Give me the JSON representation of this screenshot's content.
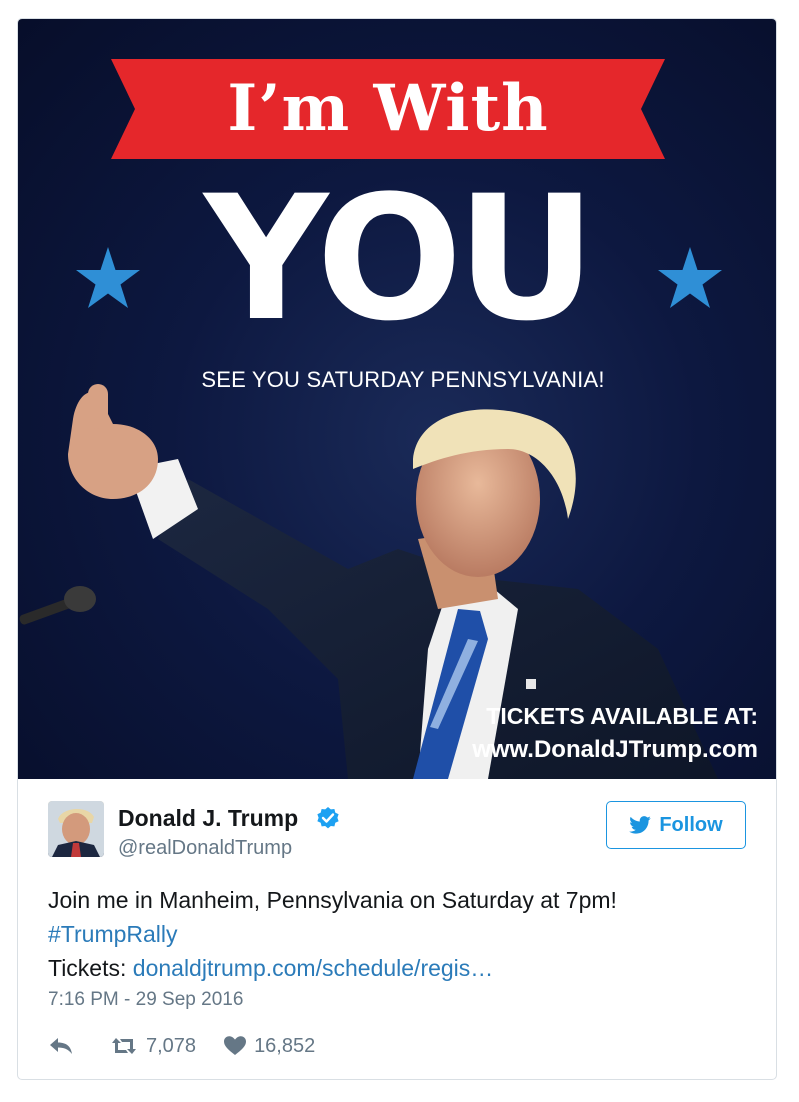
{
  "image": {
    "banner_text": "I’m With",
    "headline": "YOU",
    "subline": "SEE YOU SATURDAY PENNSYLVANIA!",
    "tickets_line1": "TICKETS AVAILABLE AT:",
    "tickets_line2": "www.DonaldJTrump.com",
    "colors": {
      "banner": "#e5272b",
      "star": "#2f8fd6",
      "background": "#0b1538"
    }
  },
  "author": {
    "name": "Donald J. Trump",
    "handle": "@realDonaldTrump",
    "verified_icon": "verified-badge-icon"
  },
  "follow_button": {
    "label": "Follow",
    "icon": "twitter-bird-icon"
  },
  "tweet": {
    "line1": "Join me in Manheim, Pennsylvania on Saturday at 7pm!",
    "hashtag": "#TrumpRally",
    "tickets_label": "Tickets: ",
    "link": "donaldjtrump.com/schedule/regis…",
    "timestamp": "7:16 PM - 29 Sep 2016"
  },
  "actions": {
    "reply_icon": "reply-icon",
    "retweet_count": "7,078",
    "like_count": "16,852"
  },
  "colors": {
    "accent": "#1b95e0",
    "link": "#2b7bb9",
    "muted": "#657786"
  }
}
